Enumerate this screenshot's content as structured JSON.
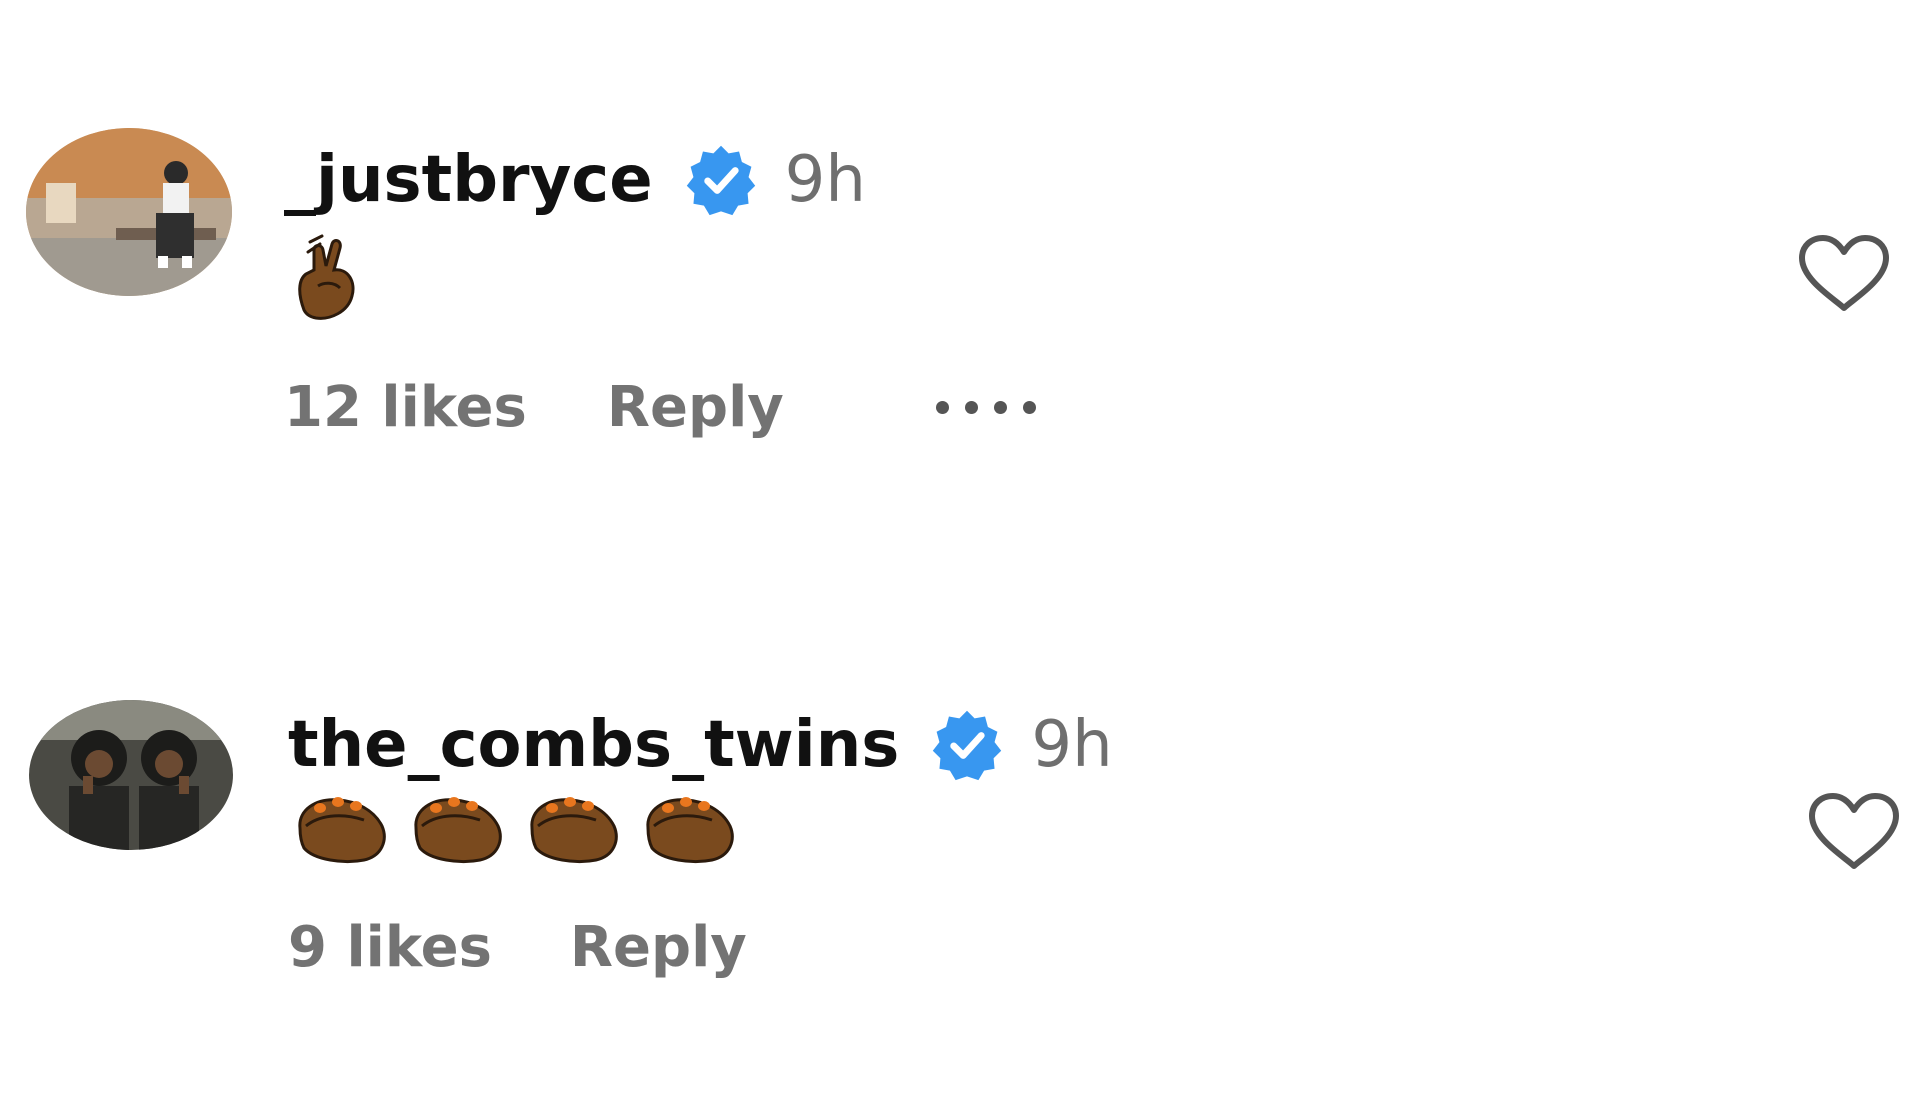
{
  "comments": [
    {
      "username": "_justbryce",
      "verified_icon": "verified-badge-icon",
      "time": "9h",
      "emoji_names": [
        "crossed-fingers-emoji"
      ],
      "likes": "12 likes",
      "reply_label": "Reply",
      "more_icon": "more-options-icon",
      "like_icon": "heart-icon"
    },
    {
      "username": "the_combs_twins",
      "verified_icon": "verified-badge-icon",
      "time": "9h",
      "emoji_names": [
        "clapping-hands-emoji",
        "clapping-hands-emoji",
        "clapping-hands-emoji",
        "clapping-hands-emoji"
      ],
      "likes": "9 likes",
      "reply_label": "Reply",
      "like_icon": "heart-icon"
    }
  ],
  "colors": {
    "verified_blue": "#3897f0",
    "meta_gray": "#737373",
    "emoji_brown": "#7a4a1e"
  }
}
